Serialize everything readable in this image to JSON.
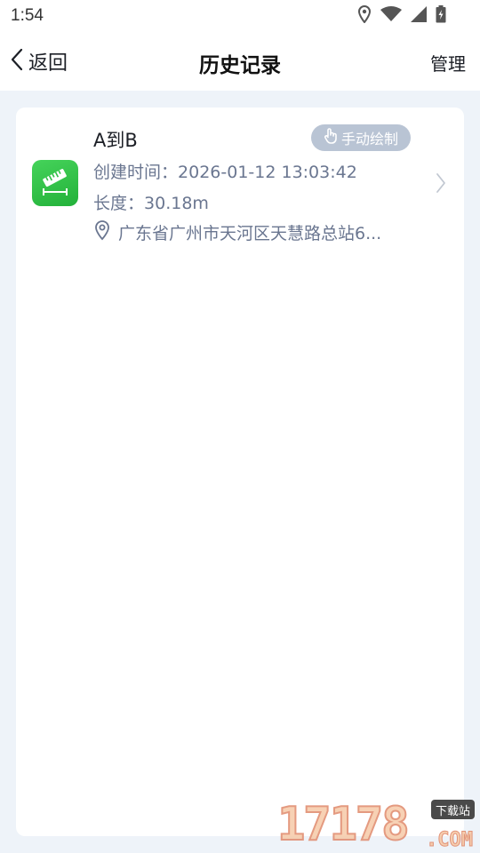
{
  "status_bar": {
    "time": "1:54",
    "icons": [
      "location-icon",
      "wifi-icon",
      "signal-icon",
      "battery-icon"
    ]
  },
  "header": {
    "back_label": "返回",
    "title": "历史记录",
    "manage_label": "管理"
  },
  "records": [
    {
      "title": "A到B",
      "badge": "手动绘制",
      "created_label": "创建时间：",
      "created_value": "2026-01-12 13:03:42",
      "length_label": "长度：",
      "length_value": "30.18m",
      "address": "广东省广州市天河区天慧路总站6..."
    }
  ],
  "watermark": {
    "number": "17178",
    "suffix": ".COM",
    "tag": "下载站"
  },
  "colors": {
    "background": "#eef3f9",
    "card": "#ffffff",
    "badge": "#b9c4d4",
    "meta_text": "#6a7690",
    "icon_green": "#2fbf45"
  }
}
